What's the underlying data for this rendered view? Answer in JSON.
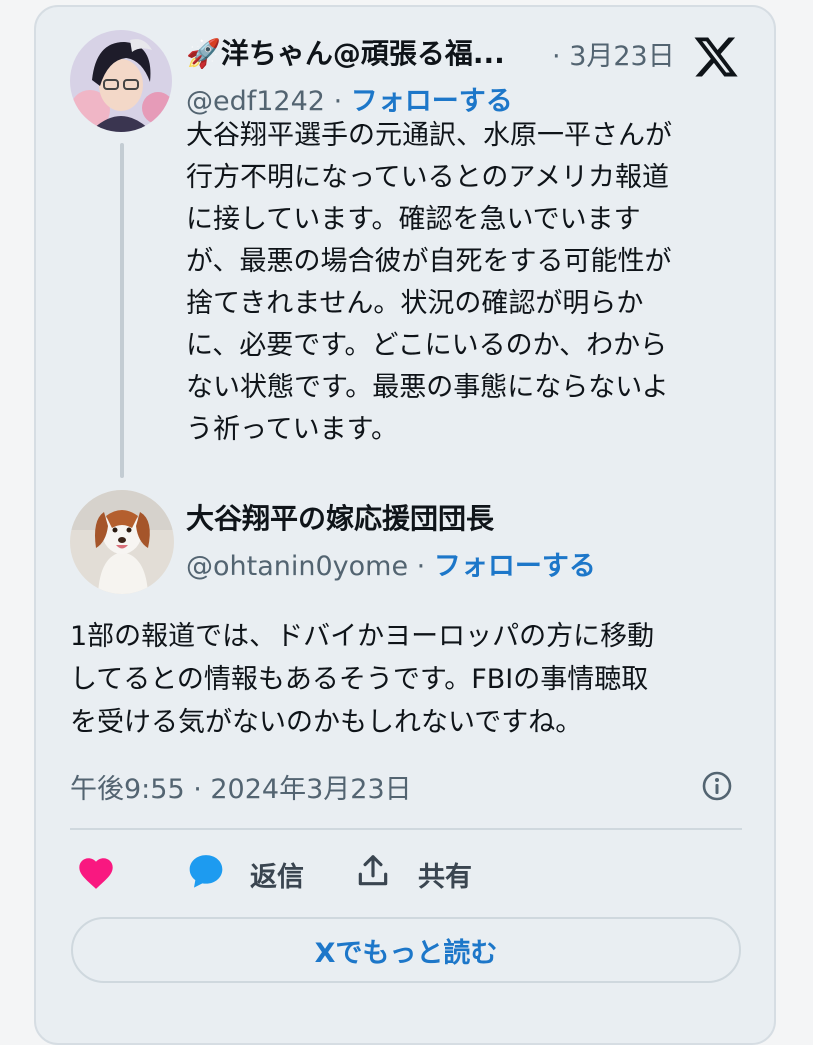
{
  "parent_tweet": {
    "rocket_emoji": "🚀",
    "display_name": "洋ちゃん@頑張る福...",
    "date_separator": "·",
    "date": "3月23日",
    "handle": "@edf1242",
    "handle_separator": "·",
    "follow_label": "フォローする",
    "text_lines": [
      "大谷翔平選手の元通訳、水原一平さんが",
      "行方不明になっているとのアメリカ報道",
      "に接しています。確認を急いでいます",
      "が、最悪の場合彼が自死をする可能性が",
      "捨てきれません。状況の確認が明らか",
      "に、必要です。どこにいるのか、わから",
      "ない状態です。最悪の事態にならないよ",
      "う祈っています。"
    ]
  },
  "reply_tweet": {
    "display_name": "大谷翔平の嫁応援団団長",
    "handle": "@ohtanin0yome",
    "handle_separator": "·",
    "follow_label": "フォローする",
    "text_lines": [
      "1部の報道では、ドバイかヨーロッパの方に移動",
      "してるとの情報もあるそうです。FBIの事情聴取",
      "を受ける気がないのかもしれないですね。"
    ],
    "timestamp": "午後9:55 · 2024年3月23日"
  },
  "actions": {
    "reply_label": "返信",
    "share_label": "共有"
  },
  "read_more_label": "Xでもっと読む",
  "icons": {
    "x_logo": "x-logo-icon",
    "info": "info-icon",
    "like": "heart-icon",
    "reply": "speech-bubble-icon",
    "share": "share-upload-icon",
    "rocket": "rocket-icon"
  },
  "colors": {
    "card_background": "#e9eef2",
    "link_blue": "#1d77c9",
    "like_pink": "#f91880",
    "reply_blue": "#1d9bf0",
    "text_dark": "#0f1419",
    "text_gray": "#536471"
  }
}
